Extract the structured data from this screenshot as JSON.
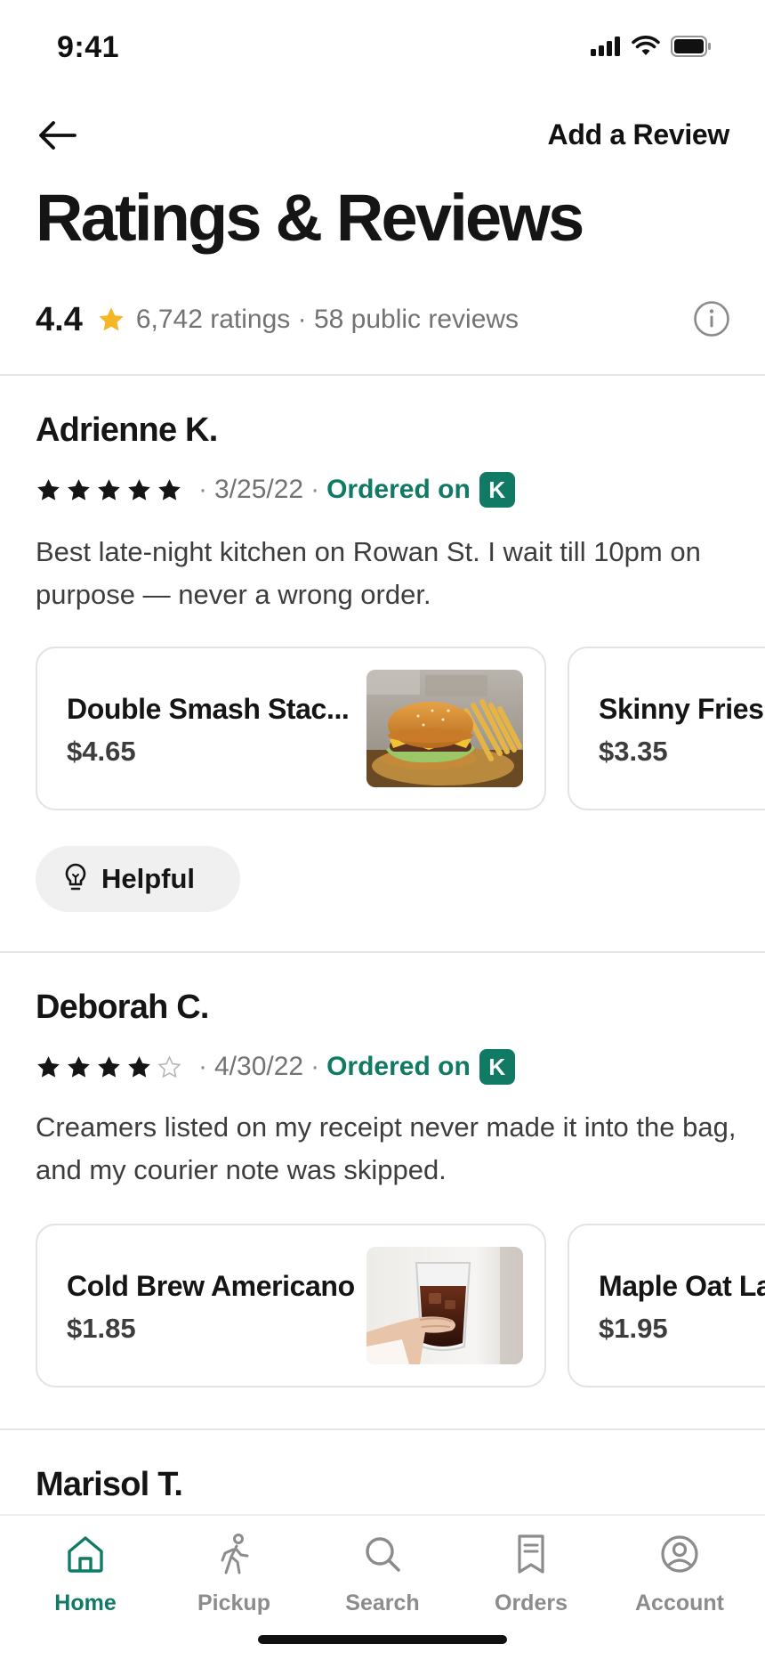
{
  "status_bar": {
    "time": "9:41"
  },
  "header": {
    "add_review_label": "Add a Review",
    "title": "Ratings & Reviews"
  },
  "summary": {
    "score": "4.4",
    "meta": "6,742 ratings · 58 public reviews"
  },
  "reviews": [
    {
      "name": "Adrienne K.",
      "stars": 5,
      "date": "3/25/22",
      "ordered_on": "Ordered on",
      "badge": "K",
      "text": "Best late-night kitchen on Rowan St. I wait till 10pm on purpose — never a wrong order.",
      "items": [
        {
          "name": "Double Smash Stac...",
          "price": "$4.65",
          "image": "burger-and-fries-photo"
        },
        {
          "name": "Skinny Fries",
          "price": "$3.35"
        }
      ],
      "helpful_label": "Helpful"
    },
    {
      "name": "Deborah C.",
      "stars": 4,
      "date": "4/30/22",
      "ordered_on": "Ordered on",
      "badge": "K",
      "text": "Creamers listed on my receipt never made it into the bag, and my courier note was skipped.",
      "items": [
        {
          "name": "Cold Brew Americano",
          "price": "$1.85",
          "image": "iced-coffee-glass-photo"
        },
        {
          "name": "Maple Oat La",
          "price": "$1.95"
        }
      ]
    },
    {
      "name": "Marisol T."
    }
  ],
  "tab_bar": {
    "tabs": [
      {
        "label": "Home",
        "icon": "home-icon",
        "active": true
      },
      {
        "label": "Pickup",
        "icon": "walking-person-icon",
        "active": false
      },
      {
        "label": "Search",
        "icon": "search-icon",
        "active": false
      },
      {
        "label": "Orders",
        "icon": "receipt-icon",
        "active": false
      },
      {
        "label": "Account",
        "icon": "account-icon",
        "active": false
      }
    ]
  },
  "colors": {
    "accent": "#117a65",
    "star_rating": "#f5b728",
    "text_primary": "#151515",
    "text_secondary": "#737373"
  }
}
